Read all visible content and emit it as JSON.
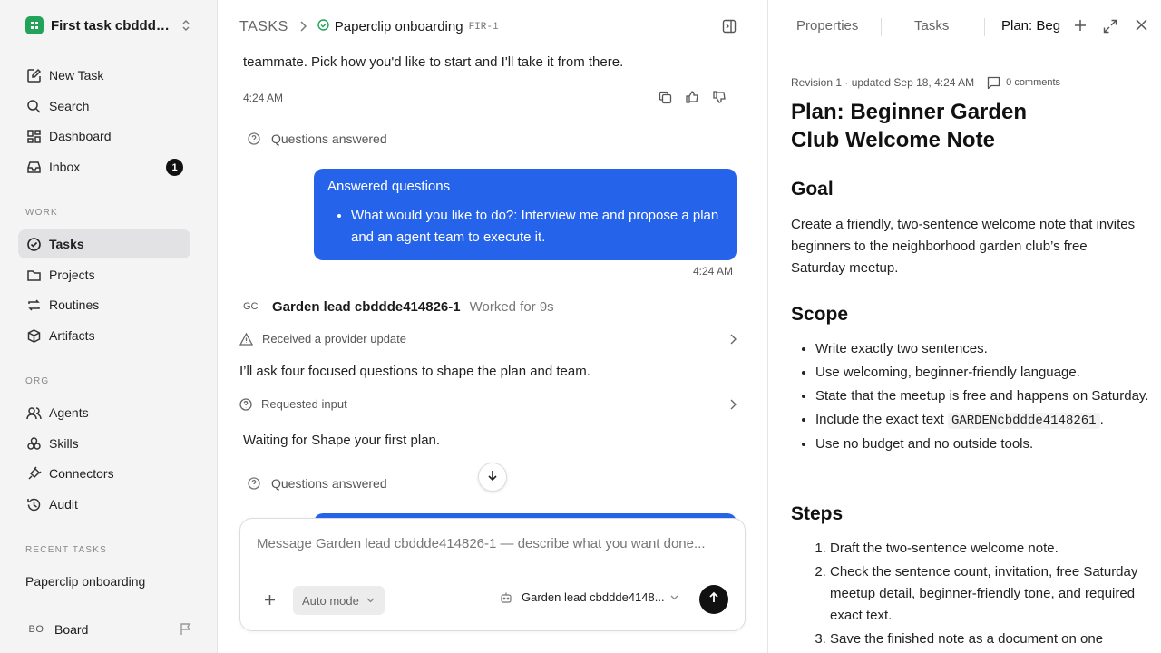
{
  "sidebar": {
    "workspace_name": "First task cbddde...",
    "nav": [
      {
        "label": "New Task"
      },
      {
        "label": "Search"
      },
      {
        "label": "Dashboard"
      },
      {
        "label": "Inbox",
        "badge": "1"
      }
    ],
    "work_label": "WORK",
    "work": [
      {
        "label": "Tasks"
      },
      {
        "label": "Projects"
      },
      {
        "label": "Routines"
      },
      {
        "label": "Artifacts"
      }
    ],
    "org_label": "ORG",
    "org": [
      {
        "label": "Agents"
      },
      {
        "label": "Skills"
      },
      {
        "label": "Connectors"
      },
      {
        "label": "Audit"
      }
    ],
    "recent_label": "RECENT TASKS",
    "recent_task": "Paperclip onboarding",
    "board_initials": "BO",
    "board_label": "Board"
  },
  "header": {
    "crumb": "TASKS",
    "task_title": "Paperclip onboarding",
    "task_id": "FIR-1"
  },
  "chat": {
    "msg1_text": "teammate. Pick how you'd like to start and I'll take it from there.",
    "msg1_time": "4:24 AM",
    "qa_label": "Questions answered",
    "bubble_title": "Answered questions",
    "bubble_item": "What would you like to do?: Interview me and propose a plan and an agent team to execute it.",
    "bubble_time": "4:24 AM",
    "agent_initials": "GC",
    "agent_name": "Garden lead cbddde414826-1",
    "agent_worked": "Worked for 9s",
    "event1": "Received a provider update",
    "msg2": "I’ll ask four focused questions to shape the plan and team.",
    "event2": "Requested input",
    "msg3": "Waiting for Shape your first plan.",
    "qa_label2": "Questions answered"
  },
  "composer": {
    "placeholder": "Message Garden lead cbddde414826-1 — describe what you want done...",
    "mode": "Auto mode",
    "agent": "Garden lead cbddde4148..."
  },
  "panel": {
    "tabs": [
      "Properties",
      "Tasks",
      "Plan: Beginner Garden Club Welcome Note"
    ],
    "revision": "Revision 1 · updated Sep 18, 4:24 AM",
    "comments": "0 comments",
    "title": "Plan: Beginner Garden Club Welcome Note",
    "goal_heading": "Goal",
    "goal_text": "Create a friendly, two-sentence welcome note that invites beginners to the neighborhood garden club’s free Saturday meetup.",
    "scope_heading": "Scope",
    "scope": [
      "Write exactly two sentences.",
      "Use welcoming, beginner-friendly language.",
      "State that the meetup is free and happens on Saturday."
    ],
    "scope_code_prefix": "Include the exact text",
    "scope_code": "GARDENcbddde4148261",
    "scope_code_suffix": ".",
    "scope_last": "Use no budget and no outside tools.",
    "steps_heading": "Steps",
    "steps": [
      "Draft the two-sentence welcome note.",
      "Check the sentence count, invitation, free Saturday meetup detail, beginner-friendly tone, and required exact text.",
      "Save the finished note as a document on one"
    ]
  },
  "colors": {
    "accent": "#2563eb",
    "sidebar_bg": "#f4f4f5",
    "active_bg": "#e2e2e4",
    "logo_green": "#22a35a"
  }
}
